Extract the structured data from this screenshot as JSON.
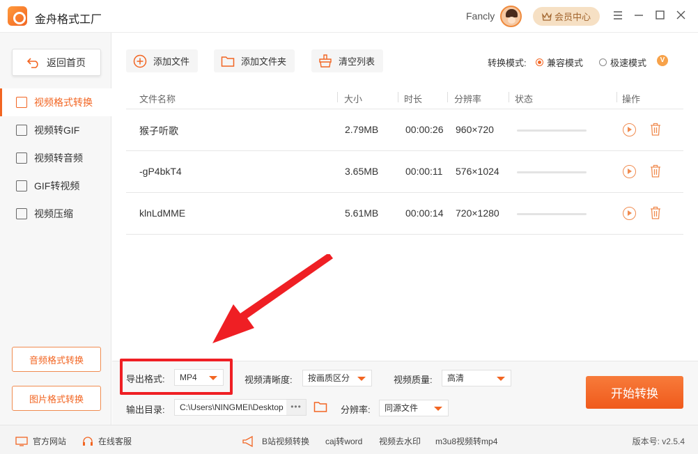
{
  "app": {
    "title": "金舟格式工厂"
  },
  "header": {
    "username": "Fancly",
    "vip_label": "会员中心"
  },
  "sidebar": {
    "home_label": "返回首页",
    "items": [
      {
        "label": "视频格式转换",
        "active": true
      },
      {
        "label": "视频转GIF"
      },
      {
        "label": "视频转音频"
      },
      {
        "label": "GIF转视频"
      },
      {
        "label": "视频压缩"
      }
    ],
    "bottom_buttons": [
      "音频格式转换",
      "图片格式转换"
    ]
  },
  "toolbar": {
    "add_file": "添加文件",
    "add_folder": "添加文件夹",
    "clear_list": "清空列表",
    "mode_label": "转换模式:",
    "mode_compatible": "兼容模式",
    "mode_fast": "极速模式",
    "vip_badge": "V"
  },
  "table": {
    "headers": {
      "name": "文件名称",
      "size": "大小",
      "duration": "时长",
      "resolution": "分辨率",
      "status": "状态",
      "actions": "操作"
    },
    "rows": [
      {
        "name": "猴子听歌",
        "size": "2.79MB",
        "duration": "00:00:26",
        "resolution": "960×720",
        "progress": 0
      },
      {
        "name": "-gP4bkT4",
        "size": "3.65MB",
        "duration": "00:00:11",
        "resolution": "576×1024",
        "progress": 0
      },
      {
        "name": "klnLdMME",
        "size": "5.61MB",
        "duration": "00:00:14",
        "resolution": "720×1280",
        "progress": 0
      }
    ]
  },
  "settings": {
    "export_format_label": "导出格式:",
    "export_format_value": "MP4",
    "clarity_label": "视频清晰度:",
    "clarity_value": "按画质区分",
    "quality_label": "视频质量:",
    "quality_value": "高清",
    "output_dir_label": "输出目录:",
    "output_dir_value": "C:\\Users\\NINGMEI\\Desktop",
    "path_more": "•••",
    "resolution_label": "分辨率:",
    "resolution_value": "同源文件",
    "start_label": "开始转换"
  },
  "footer": {
    "official_site": "官方网站",
    "online_support": "在线客服",
    "links": [
      "B站视频转换",
      "caj转word",
      "视频去水印",
      "m3u8视频转mp4"
    ],
    "version": "版本号: v2.5.4"
  },
  "colors": {
    "accent": "#f26522",
    "annotation": "#ef1f24"
  }
}
